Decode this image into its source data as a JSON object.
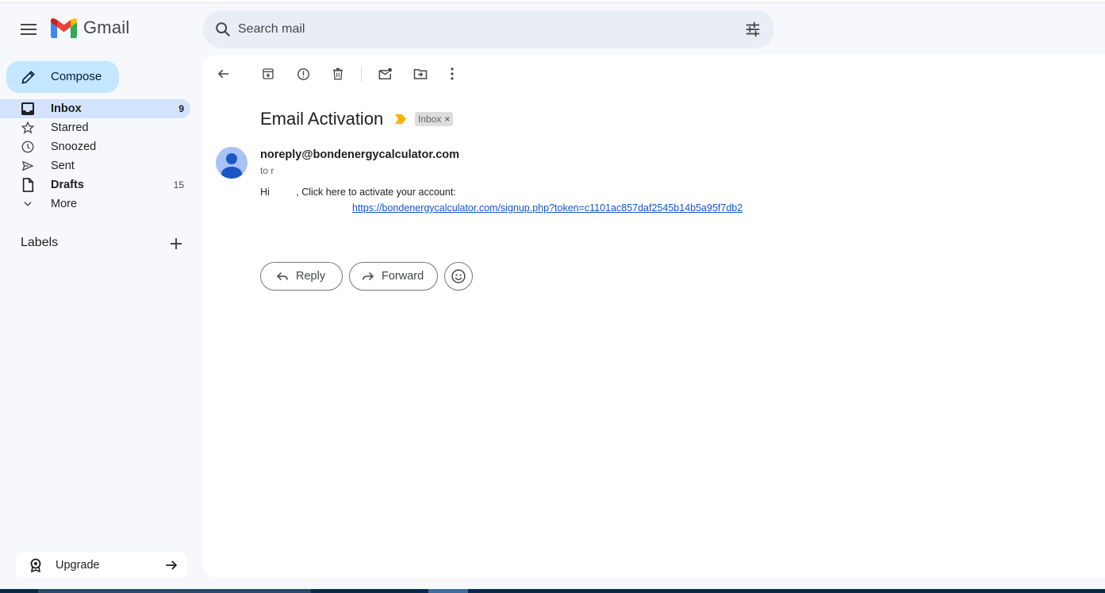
{
  "app": {
    "name": "Gmail"
  },
  "colors": {
    "accent": "#c2e7ff",
    "active_nav": "#d3e3fd",
    "link": "#1155cc",
    "important": "#f4b400"
  },
  "search": {
    "placeholder": "Search mail"
  },
  "compose": {
    "label": "Compose"
  },
  "sidebar": {
    "items": [
      {
        "label": "Inbox",
        "count": "9",
        "icon": "inbox-icon"
      },
      {
        "label": "Starred",
        "count": "",
        "icon": "star-icon"
      },
      {
        "label": "Snoozed",
        "count": "",
        "icon": "clock-icon"
      },
      {
        "label": "Sent",
        "count": "",
        "icon": "send-icon"
      },
      {
        "label": "Drafts",
        "count": "15",
        "icon": "draft-icon"
      },
      {
        "label": "More",
        "count": "",
        "icon": "chevron-down-icon"
      }
    ],
    "labels_heading": "Labels",
    "upgrade_label": "Upgrade"
  },
  "email": {
    "subject": "Email Activation",
    "label_chip": "Inbox",
    "label_chip_close": "×",
    "sender": "noreply@bondenergycalculator.com",
    "to": "to r",
    "body_prefix": "Hi ",
    "body_suffix": ", Click here to activate your account:",
    "link": "https://bondenergycalculator.com/signup.php?token=c1101ac857daf2545b14b5a95f7db2"
  },
  "actions": {
    "reply_label": "Reply",
    "forward_label": "Forward"
  }
}
